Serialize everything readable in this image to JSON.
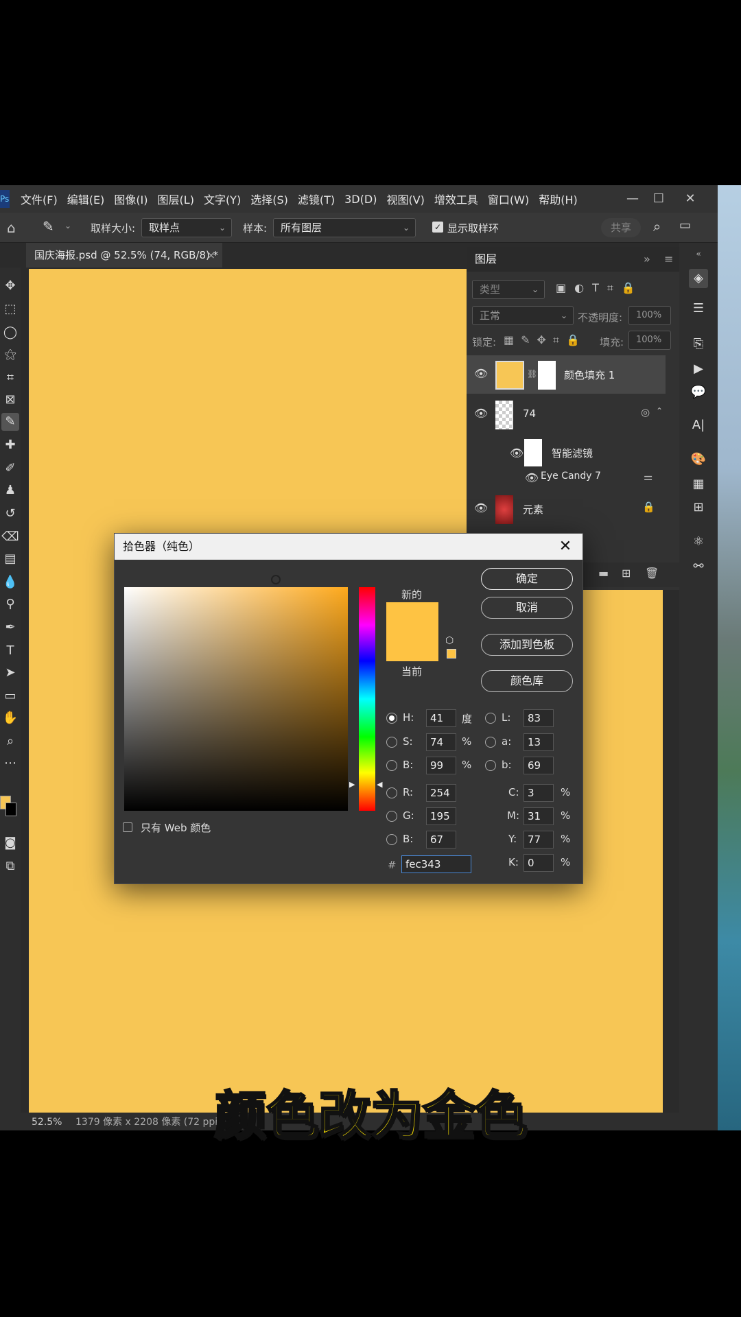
{
  "menubar": {
    "logo": "Ps",
    "items": [
      "文件(F)",
      "编辑(E)",
      "图像(I)",
      "图层(L)",
      "文字(Y)",
      "选择(S)",
      "滤镜(T)",
      "3D(D)",
      "视图(V)",
      "增效工具",
      "窗口(W)",
      "帮助(H)"
    ],
    "minimize": "—",
    "maximize": "☐",
    "close": "✕"
  },
  "options": {
    "sample_size_label": "取样大小:",
    "sample_size_value": "取样点",
    "sample_label": "样本:",
    "sample_value": "所有图层",
    "show_ring_label": "显示取样环",
    "share_label": "共享"
  },
  "document": {
    "tab_title": "国庆海报.psd @ 52.5% (74, RGB/8) *",
    "tab_close": "×",
    "zoom": "52.5%",
    "dimensions": "1379 像素 x 2208 像素 (72 ppi)"
  },
  "layers_panel": {
    "title": "图层",
    "filter_placeholder": "类型",
    "blend_mode": "正常",
    "opacity_label": "不透明度:",
    "opacity_value": "100%",
    "lock_label": "锁定:",
    "fill_label": "填充:",
    "fill_value": "100%",
    "layers": [
      {
        "name": "颜色填充 1"
      },
      {
        "name": "74"
      },
      {
        "name": "智能滤镜"
      },
      {
        "name": "Eye Candy 7"
      },
      {
        "name": "元素"
      }
    ]
  },
  "picker": {
    "title": "拾色器（纯色）",
    "close": "✕",
    "new_label": "新的",
    "current_label": "当前",
    "ok": "确定",
    "cancel": "取消",
    "add_swatch": "添加到色板",
    "color_libraries": "颜色库",
    "web_only_label": "只有 Web 颜色",
    "new_color": "#fec343",
    "fields": {
      "H": {
        "label": "H:",
        "value": "41",
        "unit": "度"
      },
      "S": {
        "label": "S:",
        "value": "74",
        "unit": "%"
      },
      "Bv": {
        "label": "B:",
        "value": "99",
        "unit": "%"
      },
      "R": {
        "label": "R:",
        "value": "254"
      },
      "G": {
        "label": "G:",
        "value": "195"
      },
      "Bc": {
        "label": "B:",
        "value": "67"
      },
      "L": {
        "label": "L:",
        "value": "83"
      },
      "a": {
        "label": "a:",
        "value": "13"
      },
      "b": {
        "label": "b:",
        "value": "69"
      },
      "C": {
        "label": "C:",
        "value": "3",
        "unit": "%"
      },
      "M": {
        "label": "M:",
        "value": "31",
        "unit": "%"
      },
      "Y": {
        "label": "Y:",
        "value": "77",
        "unit": "%"
      },
      "K": {
        "label": "K:",
        "value": "0",
        "unit": "%"
      }
    },
    "hex_label": "#",
    "hex_value": "fec343"
  },
  "subtitle": "颜色改为金色"
}
